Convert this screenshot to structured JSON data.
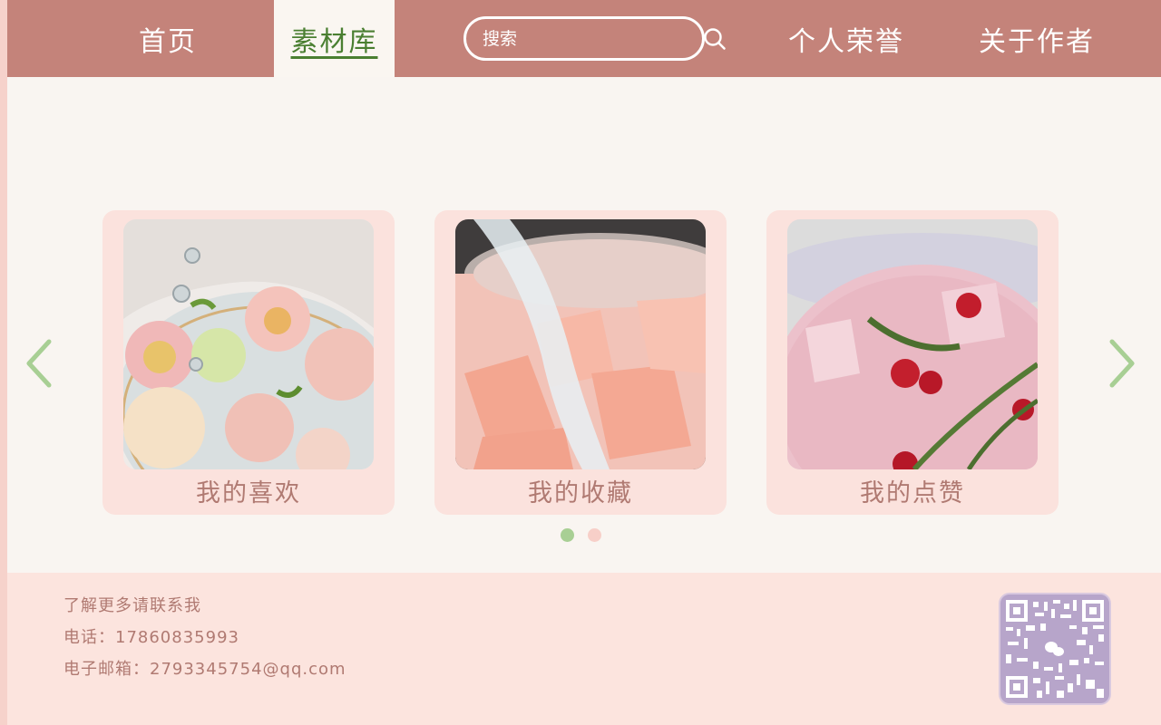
{
  "nav": {
    "home": "首页",
    "library": "素材库",
    "search_placeholder": "搜索",
    "honors": "个人荣誉",
    "about": "关于作者"
  },
  "carousel": {
    "cards": [
      {
        "label": "我的喜欢",
        "image": "flowers-in-glass-bowl"
      },
      {
        "label": "我的收藏",
        "image": "pink-jelly-cubes-jar"
      },
      {
        "label": "我的点赞",
        "image": "pink-drink-with-berries"
      }
    ],
    "active_page": 1,
    "page_count": 2
  },
  "footer": {
    "line1": "了解更多请联系我",
    "phone": "电话：17860835993",
    "email": "电子邮箱：2793345754@qq.com",
    "qr": "wechat-qr-code"
  },
  "colors": {
    "nav_bg": "#c4837a",
    "active_tab_text": "#4a7f31",
    "card_bg": "#fbe2dd",
    "footer_bg": "#fce4de",
    "text_muted": "#b07a72",
    "arrow": "#a8cf94"
  }
}
